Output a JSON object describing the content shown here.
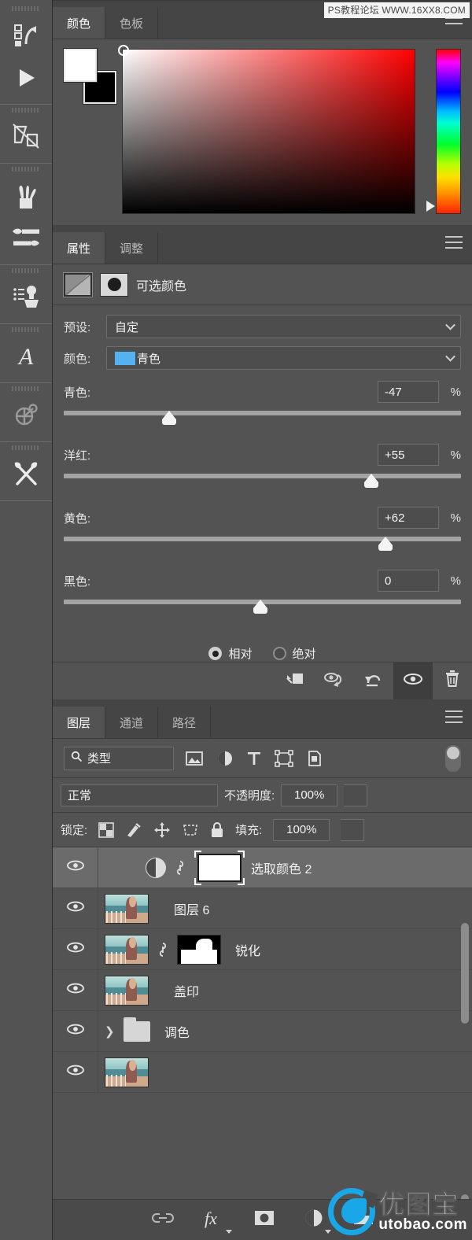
{
  "watermarks": {
    "top": "PS教程论坛 WWW.16XX8.COM",
    "bottom_cn": "优图宝",
    "bottom_en": "utobao.com"
  },
  "toolbar": {
    "tools": [
      {
        "name": "artboard-tool",
        "icon": "artboard-icon"
      },
      {
        "name": "play-tool",
        "icon": "play-icon"
      },
      {
        "name": "slice-tool",
        "icon": "slice-icon"
      },
      {
        "name": "retouch-tool",
        "icon": "healing-brush-icon"
      },
      {
        "name": "brush-tool",
        "icon": "brush-icon"
      },
      {
        "name": "clone-stamp-tool",
        "icon": "clone-stamp-icon"
      },
      {
        "name": "type-tool",
        "icon": "type-icon"
      },
      {
        "name": "path-tool",
        "icon": "path-select-icon"
      },
      {
        "name": "edit-toolbar",
        "icon": "edit-toolbar-icon"
      }
    ]
  },
  "color_panel": {
    "tabs": [
      {
        "label": "颜色",
        "active": true
      },
      {
        "label": "色板",
        "active": false
      }
    ],
    "foreground": "#ffffff",
    "background": "#000000",
    "field_base_hue": "#ff0000",
    "menu_icon": "panel-menu-icon"
  },
  "properties_panel": {
    "tabs": [
      {
        "label": "属性",
        "active": true
      },
      {
        "label": "调整",
        "active": false
      }
    ],
    "title": "可选颜色",
    "adjustment_icon": "selective-color-icon",
    "mask_icon": "layer-mask-icon",
    "menu_icon": "panel-menu-icon",
    "preset": {
      "label": "预设:",
      "value": "自定"
    },
    "color": {
      "label": "颜色:",
      "value": "青色",
      "swatch": "#55b2f0"
    },
    "sliders": [
      {
        "name": "青色:",
        "value": "-47",
        "unit": "%",
        "pos_pct": 26.5
      },
      {
        "name": "洋红:",
        "value": "+55",
        "unit": "%",
        "pos_pct": 77.5
      },
      {
        "name": "黄色:",
        "value": "+62",
        "unit": "%",
        "pos_pct": 81.0
      },
      {
        "name": "黑色:",
        "value": "0",
        "unit": "%",
        "pos_pct": 49.5
      }
    ],
    "method": {
      "relative": {
        "label": "相对",
        "selected": true
      },
      "absolute": {
        "label": "绝对",
        "selected": false
      }
    },
    "footer_buttons": [
      {
        "name": "clip-to-layer-button",
        "icon": "clip-to-layer-icon",
        "active": false
      },
      {
        "name": "toggle-previous-state-button",
        "icon": "eye-arrow-icon",
        "active": false
      },
      {
        "name": "reset-button",
        "icon": "reset-arrow-icon",
        "active": false
      },
      {
        "name": "toggle-visibility-button",
        "icon": "eye-icon",
        "active": true
      },
      {
        "name": "delete-button",
        "icon": "trash-icon",
        "active": false
      }
    ]
  },
  "layers_panel": {
    "tabs": [
      {
        "label": "图层",
        "active": true
      },
      {
        "label": "通道",
        "active": false
      },
      {
        "label": "路径",
        "active": false
      }
    ],
    "menu_icon": "panel-menu-icon",
    "filter": {
      "value": "类型",
      "search_icon": "search-icon"
    },
    "filter_icons": [
      {
        "name": "filter-pixel-icon"
      },
      {
        "name": "filter-adjustment-icon"
      },
      {
        "name": "filter-type-icon"
      },
      {
        "name": "filter-shape-icon"
      },
      {
        "name": "filter-smart-object-icon"
      }
    ],
    "filter_toggle": "filter-enable-toggle",
    "blend_mode": "正常",
    "opacity_label": "不透明度:",
    "opacity_value": "100%",
    "lock_label": "锁定:",
    "lock_icons": [
      {
        "name": "lock-transparent-pixels-icon"
      },
      {
        "name": "lock-image-pixels-icon"
      },
      {
        "name": "lock-position-icon"
      },
      {
        "name": "lock-artboard-nesting-icon"
      },
      {
        "name": "lock-all-icon"
      }
    ],
    "fill_label": "填充:",
    "fill_value": "100%",
    "layers": [
      {
        "name": "选取颜色 2",
        "type": "adjustment",
        "selected": true,
        "visible": true,
        "linked": true
      },
      {
        "name": "图层 6",
        "type": "pixel",
        "selected": false,
        "visible": true,
        "linked": false
      },
      {
        "name": "锐化",
        "type": "pixel-masked",
        "selected": false,
        "visible": true,
        "linked": true
      },
      {
        "name": "盖印",
        "type": "pixel",
        "selected": false,
        "visible": true,
        "linked": false
      },
      {
        "name": "调色",
        "type": "group",
        "selected": false,
        "visible": true,
        "linked": false
      }
    ],
    "footer_buttons": [
      {
        "name": "link-layers-button",
        "icon": "link-icon"
      },
      {
        "name": "layer-style-button",
        "icon": "fx-icon"
      },
      {
        "name": "add-layer-mask-button",
        "icon": "mask-icon"
      },
      {
        "name": "new-adjustment-layer-button",
        "icon": "adjustment-circle-icon"
      },
      {
        "name": "new-group-button",
        "icon": "folder-icon"
      }
    ]
  }
}
